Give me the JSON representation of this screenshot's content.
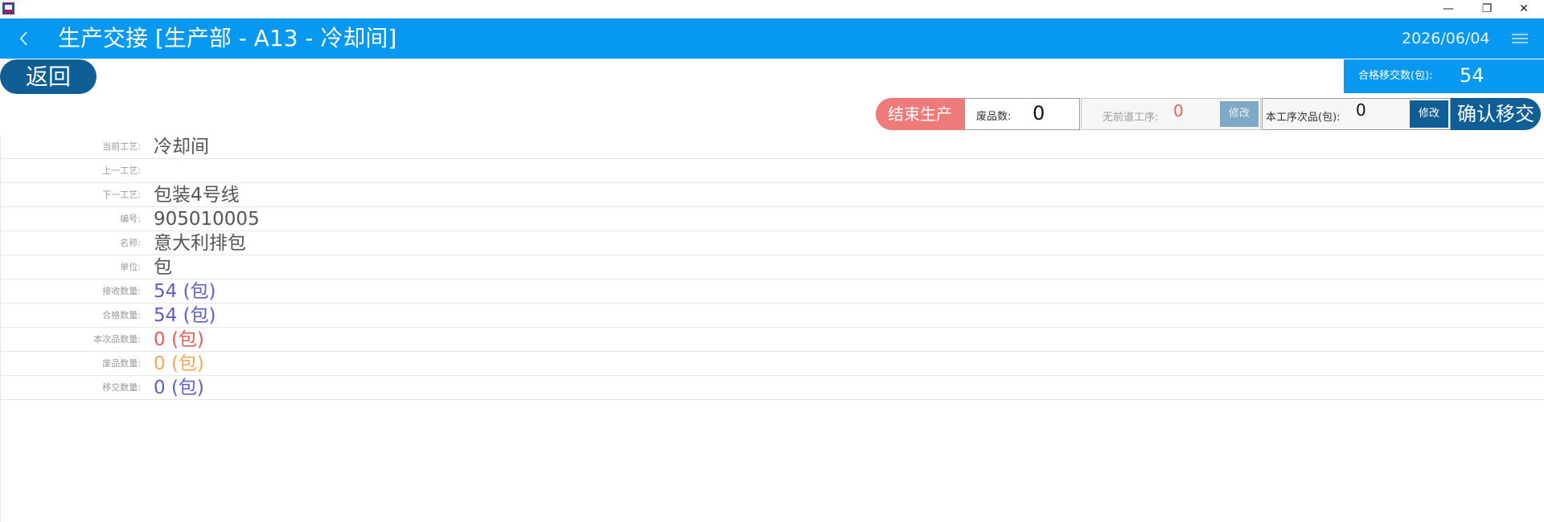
{
  "window": {
    "minimize_glyph": "—",
    "maximize_glyph": "❐",
    "close_glyph": "✕"
  },
  "header": {
    "title": "生产交接 [生产部 - A13 - 冷却间]",
    "date": "2026/06/04",
    "back_icon": "chevron-left-icon",
    "menu_icon": "hamburger-menu-icon",
    "bg_color": "#0798f2"
  },
  "return_button": {
    "label": "返回"
  },
  "qualified_transfer": {
    "label": "合格移交数(包):",
    "value": "54"
  },
  "actions": {
    "end_production": "结束生产",
    "scrap_label": "废品数:",
    "scrap_value": "0",
    "no_prev_label": "无前道工序:",
    "no_prev_value": "0",
    "no_prev_edit": "修改",
    "current_defect_label": "本工序次品(包):",
    "current_defect_value": "0",
    "current_defect_edit": "修改",
    "confirm_transfer": "确认移交"
  },
  "details": [
    {
      "label": "当前工艺:",
      "value": "冷却间",
      "style": "normal"
    },
    {
      "label": "上一工艺:",
      "value": "",
      "style": "normal"
    },
    {
      "label": "下一工艺:",
      "value": "包装4号线",
      "style": "normal"
    },
    {
      "label": "编号:",
      "value": "905010005",
      "style": "normal"
    },
    {
      "label": "名称:",
      "value": "意大利排包",
      "style": "normal"
    },
    {
      "label": "单位:",
      "value": "包",
      "style": "normal"
    },
    {
      "label": "接收数量:",
      "value": "54 (包)",
      "style": "blue"
    },
    {
      "label": "合格数量:",
      "value": "54 (包)",
      "style": "blue"
    },
    {
      "label": "本次品数量:",
      "value": "0 (包)",
      "style": "red"
    },
    {
      "label": "废品数量:",
      "value": "0 (包)",
      "style": "orange"
    },
    {
      "label": "移交数量:",
      "value": "0 (包)",
      "style": "blue"
    }
  ],
  "colors": {
    "primary": "#0798f2",
    "dark_button": "#0f5f96",
    "end_button": "#ef7a7a",
    "blue_value": "#5b5fc7",
    "red_value": "#e65a5a",
    "orange_value": "#f0aa55"
  }
}
